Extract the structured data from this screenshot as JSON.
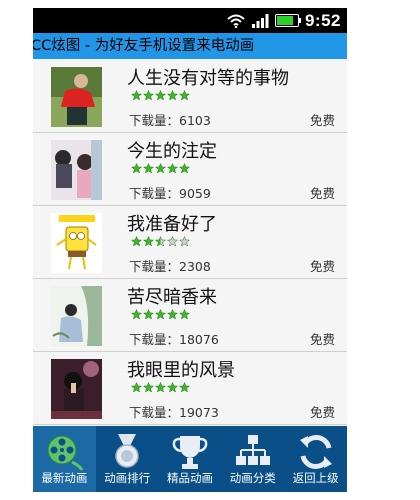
{
  "status": {
    "time": "9:52",
    "battery_level": 0.75
  },
  "header": {
    "title": "CC炫图 - 为好友手机设置来电动画"
  },
  "colors": {
    "title_bar": "#2196e6",
    "tab_bar": "#0a4f88",
    "star_on": "#3fb52a",
    "star_off": "#cfcfcf"
  },
  "download_prefix": "下载量：",
  "items": [
    {
      "title": "人生没有对等的事物",
      "rating": 5,
      "downloads": "6103",
      "price": "免费"
    },
    {
      "title": "今生的注定",
      "rating": 5,
      "downloads": "9059",
      "price": "免费"
    },
    {
      "title": "我准备好了",
      "rating": 2.5,
      "downloads": "2308",
      "price": "免费"
    },
    {
      "title": "苦尽暗香来",
      "rating": 5,
      "downloads": "18076",
      "price": "免费"
    },
    {
      "title": "我眼里的风景",
      "rating": 5,
      "downloads": "19073",
      "price": "免费"
    }
  ],
  "tabs": [
    {
      "label": "最新动画",
      "icon": "film-reel-icon",
      "active": true
    },
    {
      "label": "动画排行",
      "icon": "medal-icon",
      "active": false
    },
    {
      "label": "精品动画",
      "icon": "trophy-icon",
      "active": false
    },
    {
      "label": "动画分类",
      "icon": "hierarchy-icon",
      "active": false
    },
    {
      "label": "返回上级",
      "icon": "refresh-back-icon",
      "active": false
    }
  ]
}
